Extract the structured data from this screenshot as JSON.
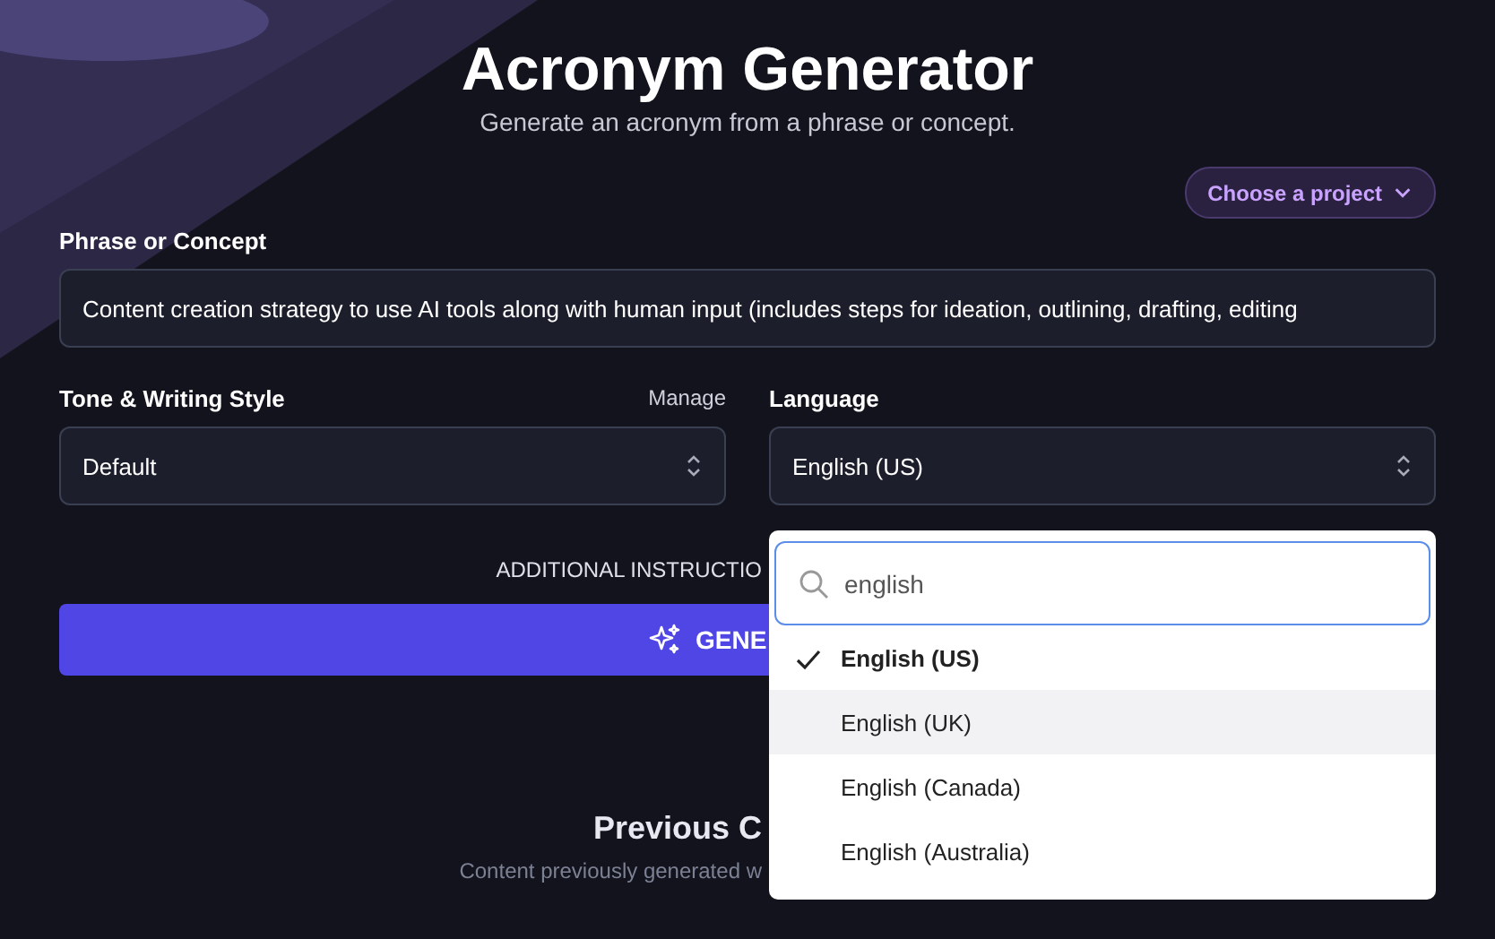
{
  "header": {
    "title": "Acronym Generator",
    "subtitle": "Generate an acronym from a phrase or concept."
  },
  "project_button": {
    "label": "Choose a project"
  },
  "phrase": {
    "label": "Phrase or Concept",
    "value": "Content creation strategy to use AI tools along with human input (includes steps for ideation, outlining, drafting, editing"
  },
  "tone": {
    "label": "Tone & Writing Style",
    "manage_link": "Manage",
    "value": "Default"
  },
  "language": {
    "label": "Language",
    "value": "English (US)"
  },
  "additional_instructions": "ADDITIONAL INSTRUCTIO",
  "generate_button": {
    "label": "GENE"
  },
  "previous": {
    "title": "Previous C",
    "subtitle": "Content previously generated w"
  },
  "dropdown": {
    "search_value": "english",
    "options": [
      {
        "label": "English (US)",
        "selected": true,
        "highlighted": false
      },
      {
        "label": "English (UK)",
        "selected": false,
        "highlighted": true
      },
      {
        "label": "English (Canada)",
        "selected": false,
        "highlighted": false
      },
      {
        "label": "English (Australia)",
        "selected": false,
        "highlighted": false
      }
    ]
  }
}
